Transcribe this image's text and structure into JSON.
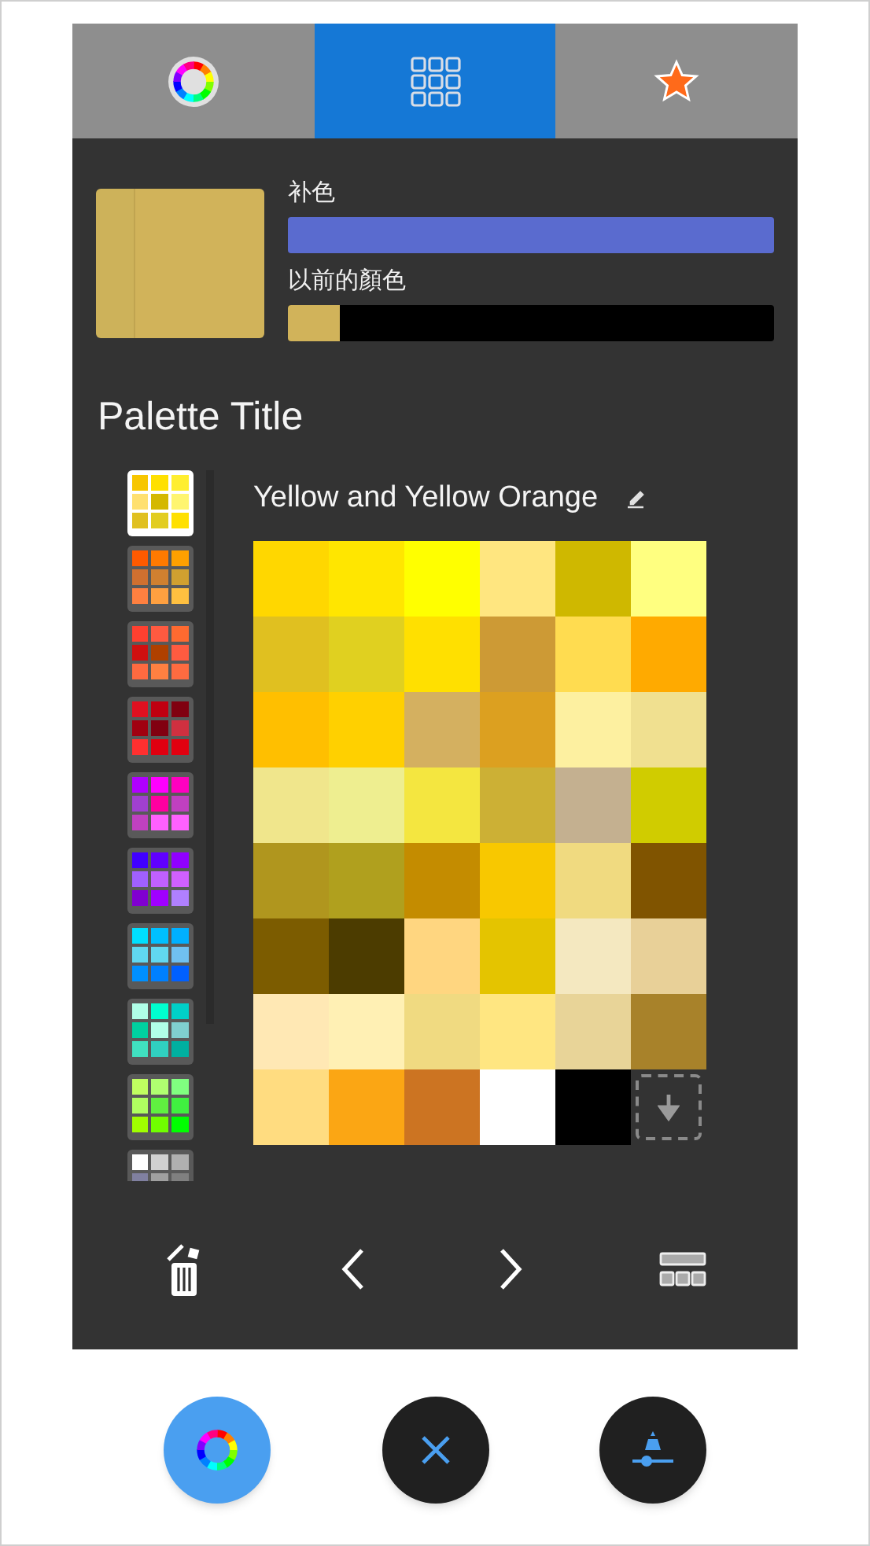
{
  "tabs": [
    {
      "kind": "wheel",
      "selected": false
    },
    {
      "kind": "grid",
      "selected": true
    },
    {
      "kind": "star",
      "selected": false
    }
  ],
  "preview": [
    {
      "color": "#cdb25a"
    },
    {
      "color": "#d1b35a"
    }
  ],
  "complementary": {
    "label": "补色",
    "color": "#5a6bcf"
  },
  "previous": {
    "label": "以前的顏色",
    "colors": [
      {
        "color": "#d1b35a"
      }
    ]
  },
  "palette_title": "Palette Title",
  "palettes": [
    {
      "selected": true,
      "colors": [
        {
          "color": "#f7c600"
        },
        {
          "color": "#ffe000"
        },
        {
          "color": "#ffee30"
        },
        {
          "color": "#ffe070"
        },
        {
          "color": "#d4b800"
        },
        {
          "color": "#fff570"
        },
        {
          "color": "#e0c020"
        },
        {
          "color": "#e2cd20"
        },
        {
          "color": "#ffe001"
        }
      ]
    },
    {
      "selected": false,
      "colors": [
        {
          "color": "#ff5a00"
        },
        {
          "color": "#ff7a00"
        },
        {
          "color": "#ffa000"
        },
        {
          "color": "#d07030"
        },
        {
          "color": "#d08030"
        },
        {
          "color": "#d0a030"
        },
        {
          "color": "#ff8040"
        },
        {
          "color": "#ffa040"
        },
        {
          "color": "#ffc040"
        }
      ]
    },
    {
      "selected": false,
      "colors": [
        {
          "color": "#ff4030"
        },
        {
          "color": "#ff5a40"
        },
        {
          "color": "#ff6a30"
        },
        {
          "color": "#d01010"
        },
        {
          "color": "#b04000"
        },
        {
          "color": "#ff5b40"
        },
        {
          "color": "#ff6a40"
        },
        {
          "color": "#ff8041"
        },
        {
          "color": "#ff6b40"
        }
      ]
    },
    {
      "selected": false,
      "colors": [
        {
          "color": "#e01020"
        },
        {
          "color": "#c00010"
        },
        {
          "color": "#800010"
        },
        {
          "color": "#a00010"
        },
        {
          "color": "#810010"
        },
        {
          "color": "#d03040"
        },
        {
          "color": "#ff3030"
        },
        {
          "color": "#e00010"
        },
        {
          "color": "#e10010"
        }
      ]
    },
    {
      "selected": false,
      "colors": [
        {
          "color": "#b000ff"
        },
        {
          "color": "#ff00ff"
        },
        {
          "color": "#ff00c0"
        },
        {
          "color": "#a040d0"
        },
        {
          "color": "#ff00a0"
        },
        {
          "color": "#c040c0"
        },
        {
          "color": "#c041c0"
        },
        {
          "color": "#ff60ff"
        },
        {
          "color": "#ff61ff"
        }
      ]
    },
    {
      "selected": false,
      "colors": [
        {
          "color": "#4000ff"
        },
        {
          "color": "#6000ff"
        },
        {
          "color": "#9000ff"
        },
        {
          "color": "#a060ff"
        },
        {
          "color": "#c060ff"
        },
        {
          "color": "#d060ff"
        },
        {
          "color": "#8000d0"
        },
        {
          "color": "#a000ff"
        },
        {
          "color": "#b080ff"
        }
      ]
    },
    {
      "selected": false,
      "colors": [
        {
          "color": "#00e0ff"
        },
        {
          "color": "#00c0ff"
        },
        {
          "color": "#00b0ff"
        },
        {
          "color": "#60d8f0"
        },
        {
          "color": "#61d8f0"
        },
        {
          "color": "#70c0f0"
        },
        {
          "color": "#0090ff"
        },
        {
          "color": "#0080ff"
        },
        {
          "color": "#0060ff"
        }
      ]
    },
    {
      "selected": false,
      "colors": [
        {
          "color": "#b0ffe8"
        },
        {
          "color": "#00ffd0"
        },
        {
          "color": "#00d0c8"
        },
        {
          "color": "#00d0a0"
        },
        {
          "color": "#b1ffe8"
        },
        {
          "color": "#80d0d0"
        },
        {
          "color": "#40e0c0"
        },
        {
          "color": "#30d0c0"
        },
        {
          "color": "#00b0a0"
        }
      ]
    },
    {
      "selected": false,
      "colors": [
        {
          "color": "#c0ff60"
        },
        {
          "color": "#b0ff70"
        },
        {
          "color": "#80ff80"
        },
        {
          "color": "#b0ff60"
        },
        {
          "color": "#60f040"
        },
        {
          "color": "#40f040"
        },
        {
          "color": "#a0ff00"
        },
        {
          "color": "#70ff00"
        },
        {
          "color": "#00ff00"
        }
      ]
    },
    {
      "selected": false,
      "colors": [
        {
          "color": "#ffffff"
        },
        {
          "color": "#d0d0d0"
        },
        {
          "color": "#b0b0b0"
        },
        {
          "color": "#8080a0"
        },
        {
          "color": "#a0a0a0"
        },
        {
          "color": "#808080"
        }
      ]
    }
  ],
  "palette_name": "Yellow and Yellow Orange",
  "swatches": [
    {
      "color": "#ffd700"
    },
    {
      "color": "#ffe600"
    },
    {
      "color": "#ffff00"
    },
    {
      "color": "#ffe680"
    },
    {
      "color": "#cfb800"
    },
    {
      "color": "#ffff80"
    },
    {
      "color": "#e0c020"
    },
    {
      "color": "#e0d020"
    },
    {
      "color": "#ffe000"
    },
    {
      "color": "#cd9a35"
    },
    {
      "color": "#ffdc50"
    },
    {
      "color": "#ffaa00"
    },
    {
      "color": "#ffbf00"
    },
    {
      "color": "#ffd000"
    },
    {
      "color": "#d4b060"
    },
    {
      "color": "#dca020"
    },
    {
      "color": "#fdf0a0"
    },
    {
      "color": "#f0e090"
    },
    {
      "color": "#f0e68c"
    },
    {
      "color": "#eeee90"
    },
    {
      "color": "#f4e640"
    },
    {
      "color": "#ccb035"
    },
    {
      "color": "#c4b090"
    },
    {
      "color": "#d0cc00"
    },
    {
      "color": "#b0961e"
    },
    {
      "color": "#b0a01e"
    },
    {
      "color": "#c48c00"
    },
    {
      "color": "#f8c800"
    },
    {
      "color": "#f0da80"
    },
    {
      "color": "#805400"
    },
    {
      "color": "#7c5c00"
    },
    {
      "color": "#4c3c00"
    },
    {
      "color": "#ffd680"
    },
    {
      "color": "#e4c400"
    },
    {
      "color": "#f4e8c0"
    },
    {
      "color": "#e8d098"
    },
    {
      "color": "#ffe8b4"
    },
    {
      "color": "#fff0b4"
    },
    {
      "color": "#f0da81"
    },
    {
      "color": "#ffe681"
    },
    {
      "color": "#e8d498"
    },
    {
      "color": "#a8822a"
    },
    {
      "color": "#ffdc80"
    },
    {
      "color": "#fba614"
    },
    {
      "color": "#cc7422"
    },
    {
      "color": "#ffffff"
    },
    {
      "color": "#000000"
    }
  ],
  "fabs": [
    {
      "kind": "wheel",
      "selected": true
    },
    {
      "kind": "close",
      "selected": false
    },
    {
      "kind": "picker",
      "selected": false
    }
  ]
}
